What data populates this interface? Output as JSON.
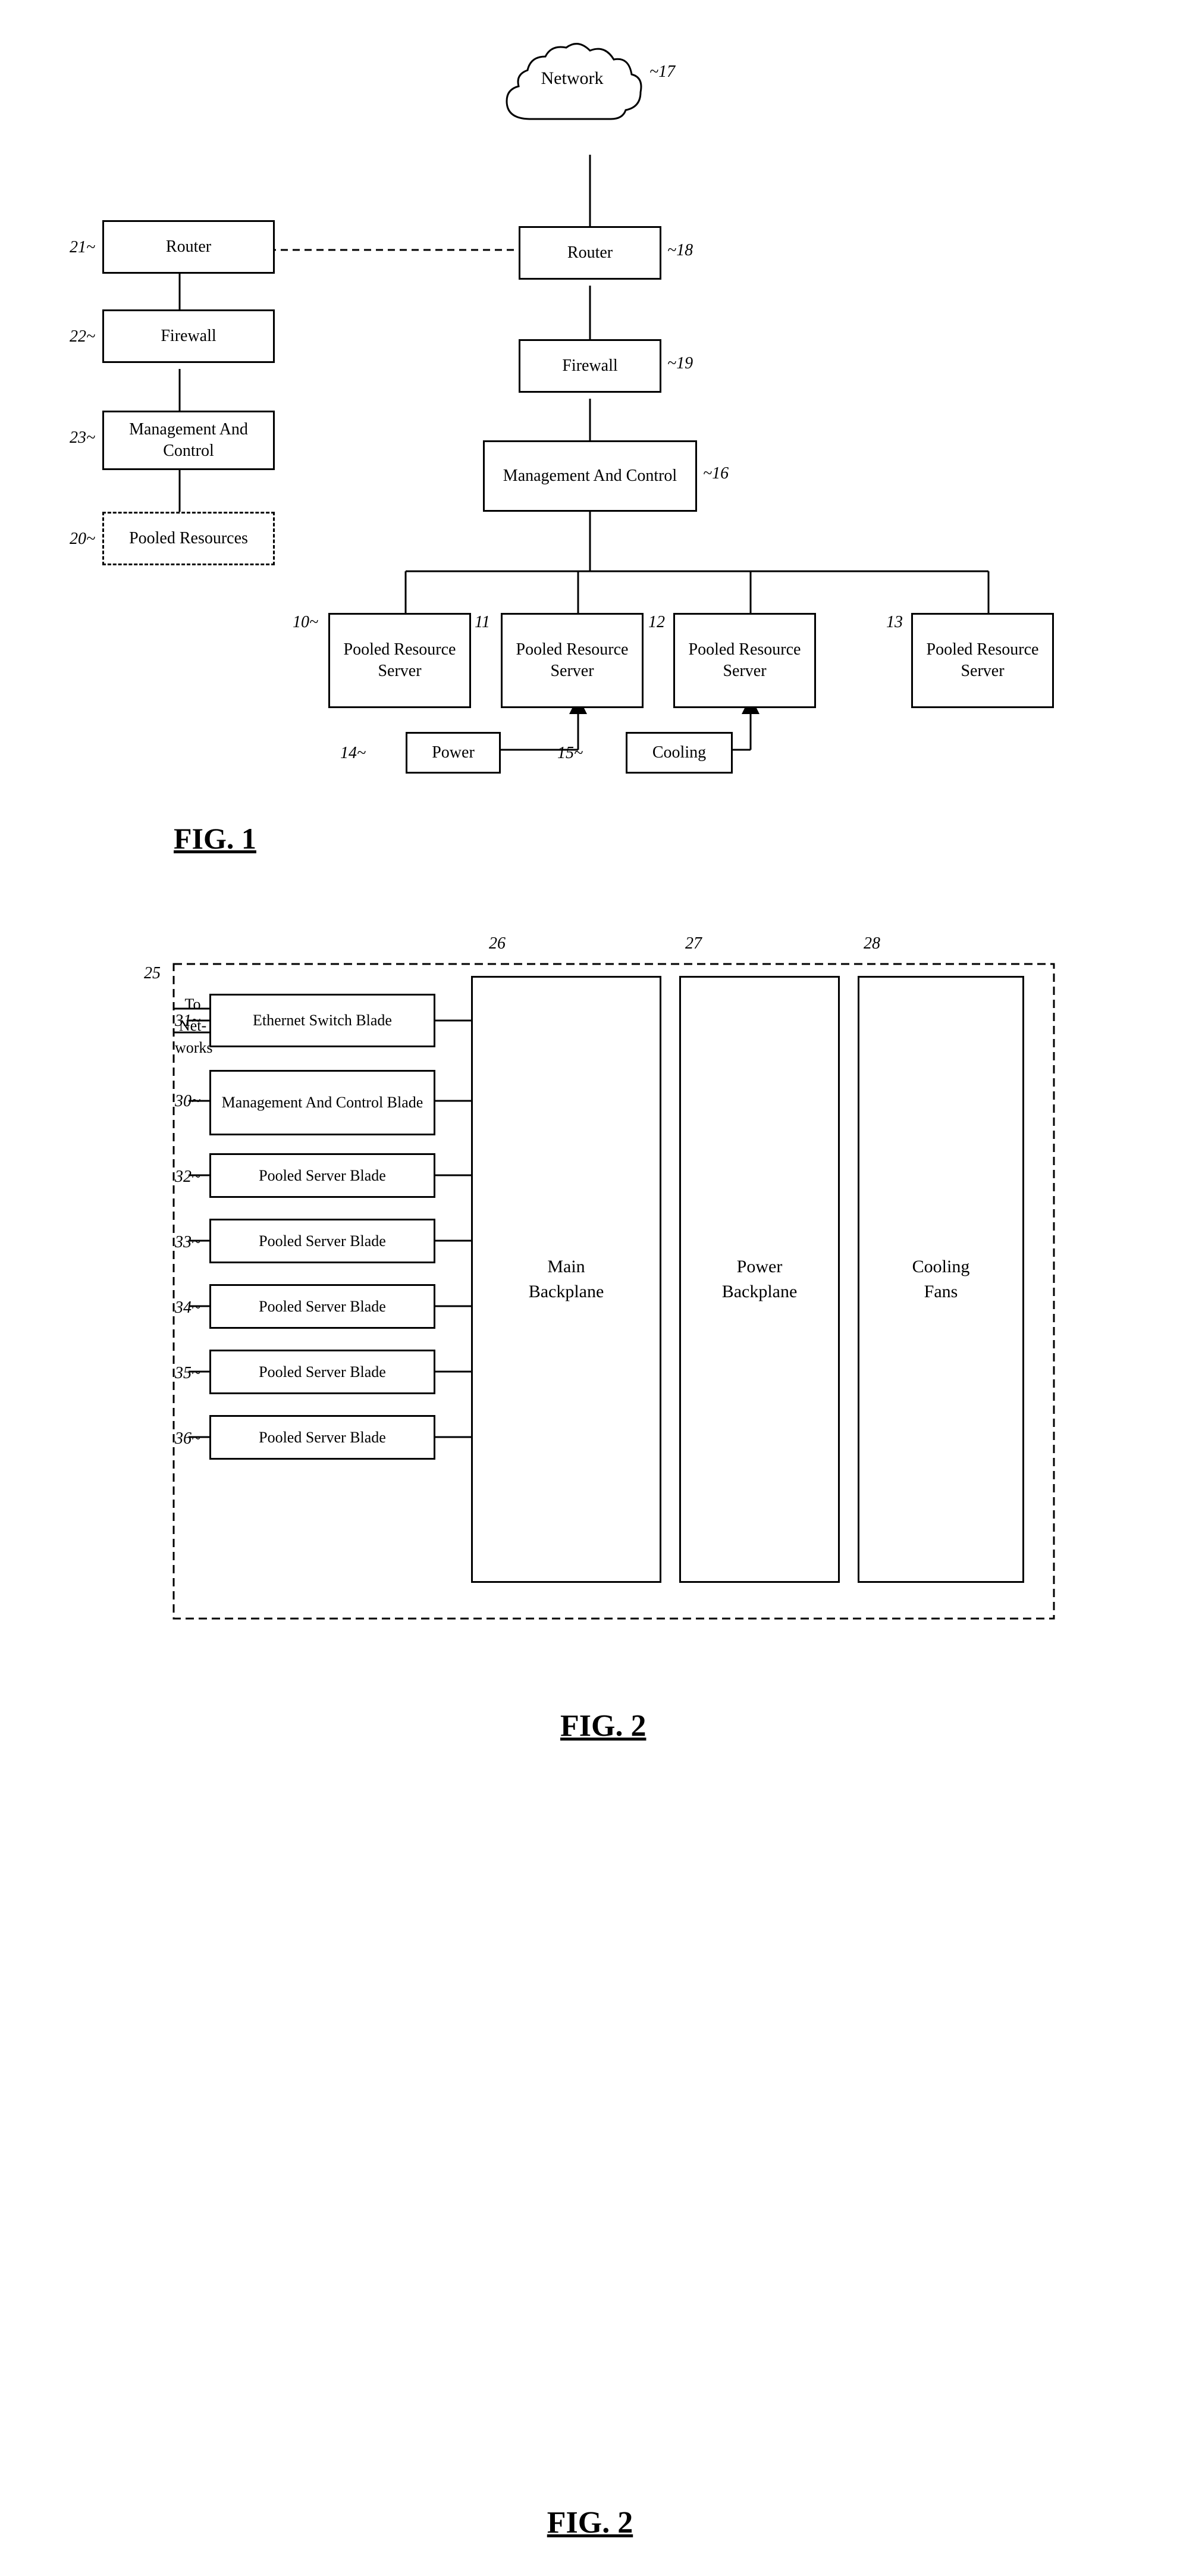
{
  "fig1": {
    "title": "FIG. 1",
    "network_label": "Network",
    "network_num": "17",
    "nodes": {
      "router_left": {
        "label": "Router",
        "num": "21"
      },
      "firewall_left": {
        "label": "Firewall",
        "num": "22"
      },
      "mgmt_left": {
        "label": "Management And Control",
        "num": "23"
      },
      "pooled_left": {
        "label": "Pooled Resources",
        "num": "20"
      },
      "router_right": {
        "label": "Router",
        "num": "18"
      },
      "firewall_right": {
        "label": "Firewall",
        "num": "19"
      },
      "mgmt_right": {
        "label": "Management And Control",
        "num": "16"
      },
      "server10": {
        "label": "Pooled Resource Server",
        "num": "10"
      },
      "server11": {
        "label": "Pooled Resource Server",
        "num": "11"
      },
      "server12": {
        "label": "Pooled Resource Server",
        "num": "12"
      },
      "server13": {
        "label": "Pooled Resource Server",
        "num": "13"
      },
      "power": {
        "label": "Power",
        "num": "14"
      },
      "cooling": {
        "label": "Cooling",
        "num": "15"
      }
    }
  },
  "fig2": {
    "title": "FIG. 2",
    "outer_num": "25",
    "to_networks": "To Networks",
    "blades": [
      {
        "label": "Ethernet Switch Blade",
        "num": "31"
      },
      {
        "label": "Management And Control Blade",
        "num": "30"
      },
      {
        "label": "Pooled Server Blade",
        "num": "32"
      },
      {
        "label": "Pooled Server Blade",
        "num": "33"
      },
      {
        "label": "Pooled Server Blade",
        "num": "34"
      },
      {
        "label": "Pooled Server Blade",
        "num": "35"
      },
      {
        "label": "Pooled Server Blade",
        "num": "36"
      }
    ],
    "backplanes": [
      {
        "label": "Main Backplane",
        "num": "26"
      },
      {
        "label": "Power Backplane",
        "num": "27"
      },
      {
        "label": "Cooling Fans",
        "num": "28"
      }
    ]
  }
}
